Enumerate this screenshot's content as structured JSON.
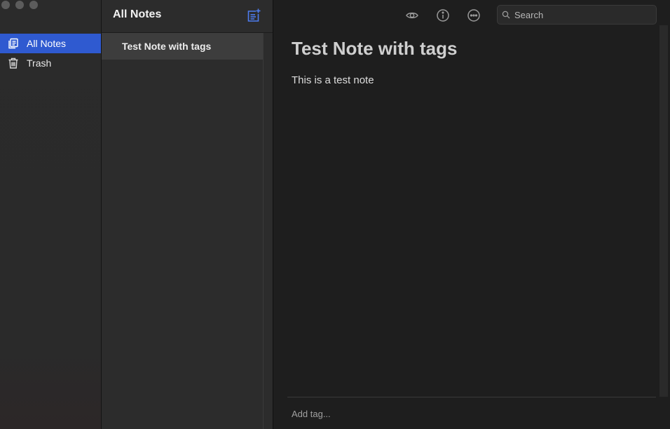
{
  "window": {
    "controls": [
      "close",
      "minimize",
      "zoom"
    ]
  },
  "sidebar": {
    "items": [
      {
        "label": "All Notes",
        "icon": "notes-stack-icon",
        "active": true
      },
      {
        "label": "Trash",
        "icon": "trash-icon",
        "active": false
      }
    ],
    "accent": "#2f5ad0"
  },
  "notes_list": {
    "title": "All Notes",
    "new_note_icon": "new-note-icon",
    "notes": [
      {
        "title": "Test Note with tags",
        "selected": true
      }
    ]
  },
  "toolbar": {
    "icons": [
      "preview-eye-icon",
      "info-icon",
      "more-ellipsis-icon"
    ],
    "search": {
      "placeholder": "Search",
      "value": ""
    }
  },
  "editor": {
    "title": "Test Note with tags",
    "body": "This is a test note",
    "tag_placeholder": "Add tag..."
  }
}
